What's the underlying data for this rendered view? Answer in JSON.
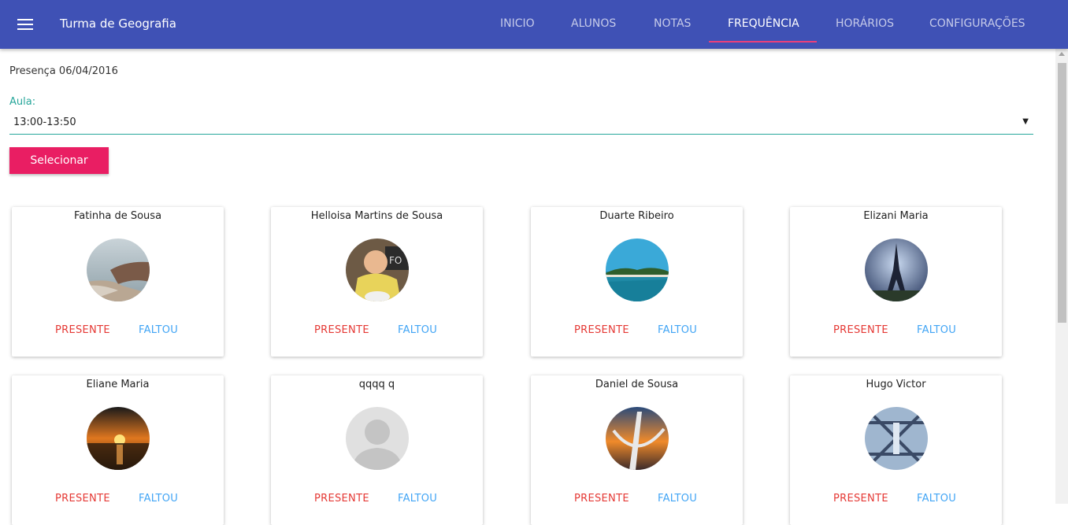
{
  "app": {
    "title": "Turma de Geografia"
  },
  "nav": {
    "tabs": [
      {
        "label": "INICIO"
      },
      {
        "label": "ALUNOS"
      },
      {
        "label": "NOTAS"
      },
      {
        "label": "FREQUÊNCIA",
        "active": true
      },
      {
        "label": "HORÁRIOS"
      },
      {
        "label": "CONFIGURAÇÕES"
      }
    ]
  },
  "attendance": {
    "date_label": "Presença 06/04/2016",
    "class_label": "Aula:",
    "class_selected": "13:00-13:50",
    "select_button": "Selecionar"
  },
  "students": [
    {
      "name": "Fatinha de Sousa",
      "present_label": "PRESENTE",
      "absent_label": "FALTOU",
      "photo": "coastal-cliffs"
    },
    {
      "name": "Helloisa Martins de Sousa",
      "present_label": "PRESENTE",
      "absent_label": "FALTOU",
      "photo": "baby"
    },
    {
      "name": "Duarte Ribeiro",
      "present_label": "PRESENTE",
      "absent_label": "FALTOU",
      "photo": "tropical-beach"
    },
    {
      "name": "Elizani Maria",
      "present_label": "PRESENTE",
      "absent_label": "FALTOU",
      "photo": "eiffel-tower"
    },
    {
      "name": "Eliane Maria",
      "present_label": "PRESENTE",
      "absent_label": "FALTOU",
      "photo": "sunset-sea"
    },
    {
      "name": "qqqq q",
      "present_label": "PRESENTE",
      "absent_label": "FALTOU",
      "photo": "default-avatar"
    },
    {
      "name": "Daniel de Sousa",
      "present_label": "PRESENTE",
      "absent_label": "FALTOU",
      "photo": "sunset-monument"
    },
    {
      "name": "Hugo Victor",
      "present_label": "PRESENTE",
      "absent_label": "FALTOU",
      "photo": "bridge"
    }
  ],
  "colors": {
    "appbar": "#3f51b5",
    "tab_indicator": "#ec407a",
    "accent_teal": "#26a69a",
    "button_pink": "#e91e63",
    "present_red": "#e53935",
    "absent_blue": "#42a5f5"
  }
}
